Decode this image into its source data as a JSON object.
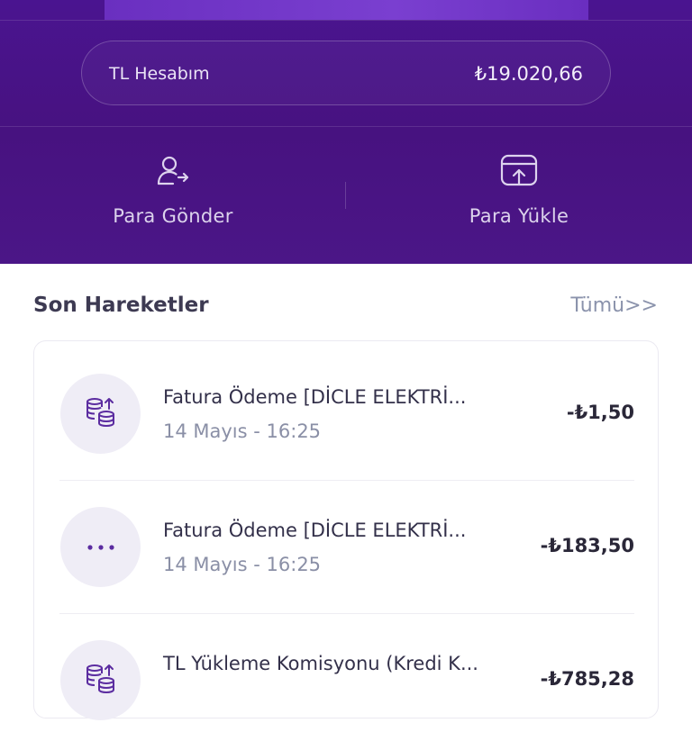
{
  "account": {
    "label": "TL Hesabım",
    "balance": "₺19.020,66"
  },
  "actions": [
    {
      "label": "Para Gönder",
      "icon": "send-money-icon"
    },
    {
      "label": "Para Yükle",
      "icon": "load-money-icon"
    }
  ],
  "transactions_section": {
    "title": "Son Hareketler",
    "see_all": "Tümü>>"
  },
  "transactions": [
    {
      "title": "Fatura Ödeme [DİCLE ELEKTRİ...",
      "date": "14 Mayıs - 16:25",
      "amount": "-₺1,50",
      "icon": "coins-upload-icon"
    },
    {
      "title": "Fatura Ödeme [DİCLE ELEKTRİ...",
      "date": "14 Mayıs - 16:25",
      "amount": "-₺183,50",
      "icon": "more-dots-icon"
    },
    {
      "title": "TL Yükleme Komisyonu (Kredi K...",
      "date": "",
      "amount": "-₺785,28",
      "icon": "coins-upload-icon"
    }
  ],
  "colors": {
    "header_purple": "#4a1490",
    "accent_purple": "#5b2ca0",
    "avatar_bg": "#efedf6"
  }
}
